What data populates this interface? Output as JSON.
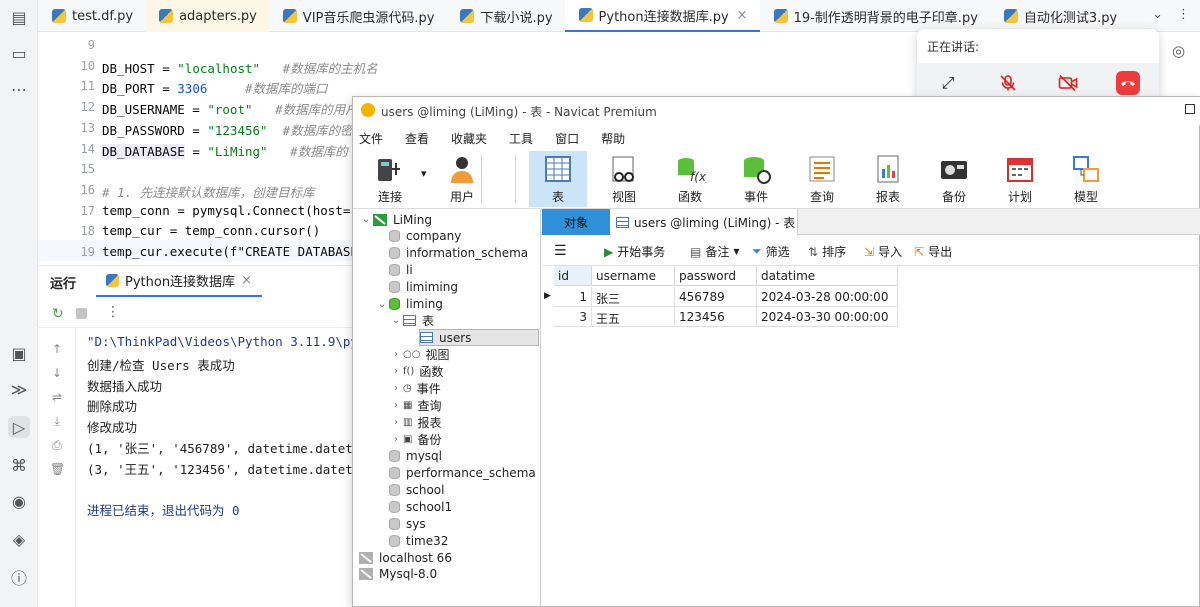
{
  "ide": {
    "tabs": [
      {
        "label": "test.df.py"
      },
      {
        "label": "adapters.py"
      },
      {
        "label": "VIP音乐爬虫源代码.py"
      },
      {
        "label": "下载小说.py"
      },
      {
        "label": "Python连接数据库.py"
      },
      {
        "label": "19-制作透明背景的电子印章.py"
      },
      {
        "label": "自动化测试3.py"
      }
    ],
    "active_tab_index": 4,
    "code_lines": [
      {
        "no": "9",
        "parts": []
      },
      {
        "no": "10",
        "parts": [
          {
            "t": "DB_HOST = ",
            "c": ""
          },
          {
            "t": "\"localhost\"",
            "c": "str"
          },
          {
            "t": "   ",
            "c": ""
          },
          {
            "t": "#数据库的主机名",
            "c": "cmt"
          }
        ]
      },
      {
        "no": "11",
        "parts": [
          {
            "t": "DB_PORT = ",
            "c": ""
          },
          {
            "t": "3306",
            "c": "num"
          },
          {
            "t": "     ",
            "c": ""
          },
          {
            "t": "#数据库的端口",
            "c": "cmt"
          }
        ]
      },
      {
        "no": "12",
        "parts": [
          {
            "t": "DB_USERNAME = ",
            "c": ""
          },
          {
            "t": "\"root\"",
            "c": "str"
          },
          {
            "t": "   ",
            "c": ""
          },
          {
            "t": "#数据库的用户",
            "c": "cmt"
          }
        ]
      },
      {
        "no": "13",
        "parts": [
          {
            "t": "DB_PASSWORD = ",
            "c": ""
          },
          {
            "t": "\"123456\"",
            "c": "str"
          },
          {
            "t": "  ",
            "c": ""
          },
          {
            "t": "#数据库的密",
            "c": "cmt"
          }
        ]
      },
      {
        "no": "14",
        "parts": [
          {
            "t": "DB_DATABASE",
            "c": "hl"
          },
          {
            "t": " = ",
            "c": ""
          },
          {
            "t": "\"LiMing\"",
            "c": "str"
          },
          {
            "t": "   ",
            "c": ""
          },
          {
            "t": "#数据库的",
            "c": "cmt"
          }
        ]
      },
      {
        "no": "15",
        "parts": []
      },
      {
        "no": "16",
        "parts": [
          {
            "t": "# 1. 先连接默认数据库，创建目标库",
            "c": "cmt"
          }
        ]
      },
      {
        "no": "17",
        "parts": [
          {
            "t": "temp_conn = pymysql.Connect(host=",
            "c": ""
          }
        ]
      },
      {
        "no": "18",
        "parts": [
          {
            "t": "temp_cur = temp_conn.cursor()",
            "c": ""
          }
        ]
      },
      {
        "no": "19",
        "parts": [
          {
            "t": "temp_cur.execute(f\"CREATE DATABASE",
            "c": ""
          }
        ]
      }
    ],
    "run_panel": {
      "label": "运行",
      "tab": "Python连接数据库",
      "output": [
        "\"D:\\ThinkPad\\Videos\\Python 3.11.9\\py",
        "创建/检查 Users 表成功",
        "数据插入成功",
        "删除成功",
        "修改成功",
        "(1, '张三', '456789', datetime.datet",
        "(3, '王五', '123456', datetime.datet",
        "",
        "进程已结束，退出代码为 0"
      ]
    }
  },
  "meeting": {
    "title": "正在讲话:"
  },
  "navicat": {
    "title": "users @liming (LiMing) - 表 - Navicat Premium",
    "menu": [
      "文件",
      "查看",
      "收藏夹",
      "工具",
      "窗口",
      "帮助"
    ],
    "toolbar": [
      "连接",
      "用户",
      "表",
      "视图",
      "函数",
      "事件",
      "查询",
      "报表",
      "备份",
      "计划",
      "模型"
    ],
    "selected_tool": "表",
    "tree": [
      {
        "label": "LiMing",
        "kind": "conn-open",
        "depth": 0
      },
      {
        "label": "company",
        "kind": "db",
        "depth": 1
      },
      {
        "label": "information_schema",
        "kind": "db",
        "depth": 1
      },
      {
        "label": "li",
        "kind": "db",
        "depth": 1
      },
      {
        "label": "limiming",
        "kind": "db",
        "depth": 1
      },
      {
        "label": "liming",
        "kind": "db-open",
        "depth": 1
      },
      {
        "label": "表",
        "kind": "folder-open",
        "depth": 2
      },
      {
        "label": "users",
        "kind": "table",
        "depth": 3
      },
      {
        "label": "视图",
        "kind": "folder",
        "depth": 2
      },
      {
        "label": "函数",
        "kind": "folder",
        "depth": 2
      },
      {
        "label": "事件",
        "kind": "folder",
        "depth": 2
      },
      {
        "label": "查询",
        "kind": "folder",
        "depth": 2
      },
      {
        "label": "报表",
        "kind": "folder",
        "depth": 2
      },
      {
        "label": "备份",
        "kind": "folder",
        "depth": 2
      },
      {
        "label": "mysql",
        "kind": "db",
        "depth": 1
      },
      {
        "label": "performance_schema",
        "kind": "db",
        "depth": 1
      },
      {
        "label": "school",
        "kind": "db",
        "depth": 1
      },
      {
        "label": "school1",
        "kind": "db",
        "depth": 1
      },
      {
        "label": "sys",
        "kind": "db",
        "depth": 1
      },
      {
        "label": "time32",
        "kind": "db",
        "depth": 1
      },
      {
        "label": "localhost 66",
        "kind": "conn",
        "depth": 0
      },
      {
        "label": "Mysql-8.0",
        "kind": "conn",
        "depth": 0
      }
    ],
    "object_tab": "对象",
    "data_tab": "users @liming (LiMing) - 表",
    "actions": [
      "开始事务",
      "备注",
      "筛选",
      "排序",
      "导入",
      "导出"
    ],
    "grid": {
      "columns": [
        "id",
        "username",
        "password",
        "datatime"
      ],
      "rows": [
        [
          "1",
          "张三",
          "456789",
          "2024-03-28 00:00:00"
        ],
        [
          "3",
          "王五",
          "123456",
          "2024-03-30 00:00:00"
        ]
      ]
    }
  }
}
